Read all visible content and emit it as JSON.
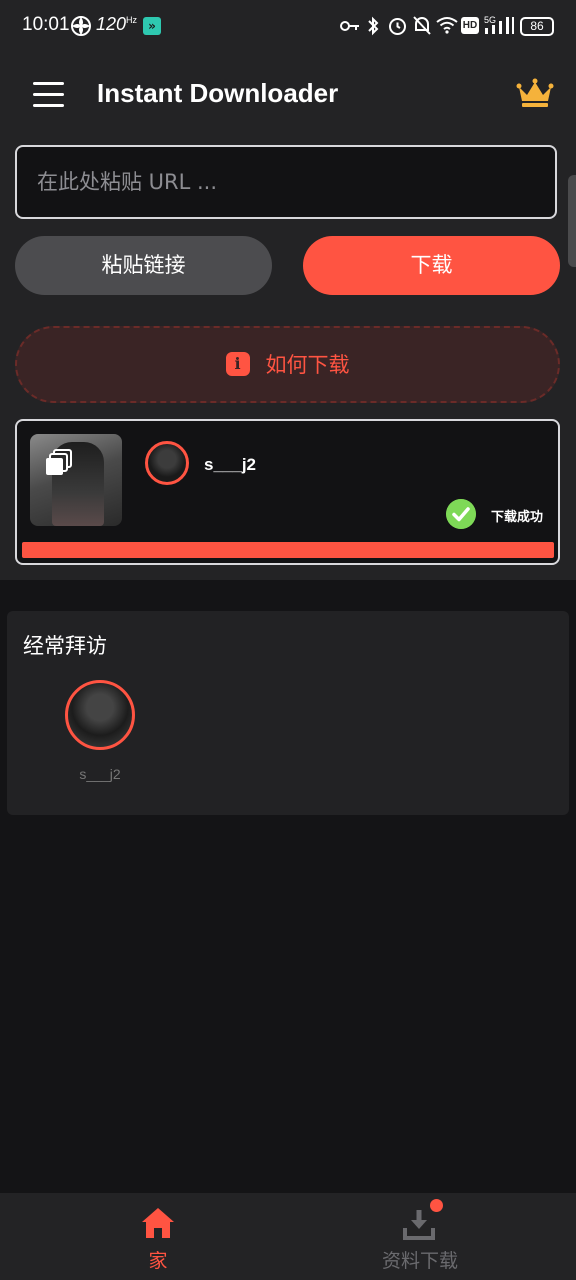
{
  "status_bar": {
    "time": "10:01",
    "refresh_rate": "120",
    "battery": "86"
  },
  "app_bar": {
    "title": "Instant Downloader"
  },
  "input": {
    "placeholder": "在此处粘贴 URL ...",
    "value": ""
  },
  "buttons": {
    "paste": "粘贴链接",
    "download": "下载",
    "how_to": "如何下载"
  },
  "download_item": {
    "username": "s___j2",
    "status": "下载成功",
    "progress": 1.0
  },
  "frequent": {
    "title": "经常拜访",
    "items": [
      {
        "name": "s___j2"
      }
    ]
  },
  "nav": {
    "home": "家",
    "downloads": "资料下载"
  },
  "colors": {
    "accent": "#ff5442",
    "success": "#7ed957",
    "crown": "#f5b23b"
  },
  "icons": [
    "menu-icon",
    "crown-icon",
    "info-icon",
    "carousel-icon",
    "check-icon",
    "home-icon",
    "download-icon"
  ]
}
